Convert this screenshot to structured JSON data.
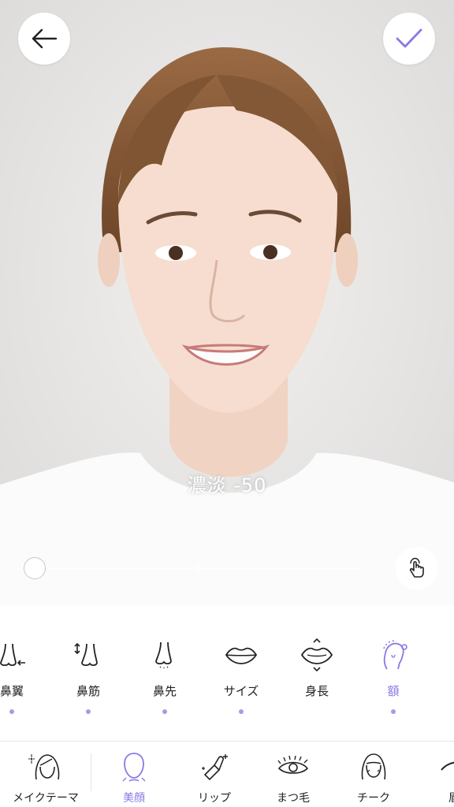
{
  "intensity": {
    "label": "濃淡",
    "value": "-50"
  },
  "slider": {
    "value": -50
  },
  "sub_items": [
    {
      "label": "鼻翼",
      "icon": "nose-wing-icon",
      "dot": true
    },
    {
      "label": "鼻筋",
      "icon": "nose-bridge-icon",
      "dot": true
    },
    {
      "label": "鼻先",
      "icon": "nose-tip-icon",
      "dot": true
    },
    {
      "label": "サイズ",
      "icon": "lips-icon",
      "dot": true
    },
    {
      "label": "身長",
      "icon": "lip-height-icon",
      "dot": false
    },
    {
      "label": "額",
      "icon": "forehead-icon",
      "dot": true,
      "active": true
    }
  ],
  "tabs": [
    {
      "label": "メイクテーマ",
      "icon": "makeup-theme-icon"
    },
    {
      "label": "美顔",
      "icon": "face-shape-icon",
      "active": true
    },
    {
      "label": "リップ",
      "icon": "lipstick-icon"
    },
    {
      "label": "まつ毛",
      "icon": "eyelash-icon"
    },
    {
      "label": "チーク",
      "icon": "cheek-icon"
    },
    {
      "label": "眉",
      "icon": "eyebrow-icon"
    }
  ],
  "colors": {
    "accent": "#8a79e6",
    "dot": "#a79be6",
    "text": "#222222"
  }
}
